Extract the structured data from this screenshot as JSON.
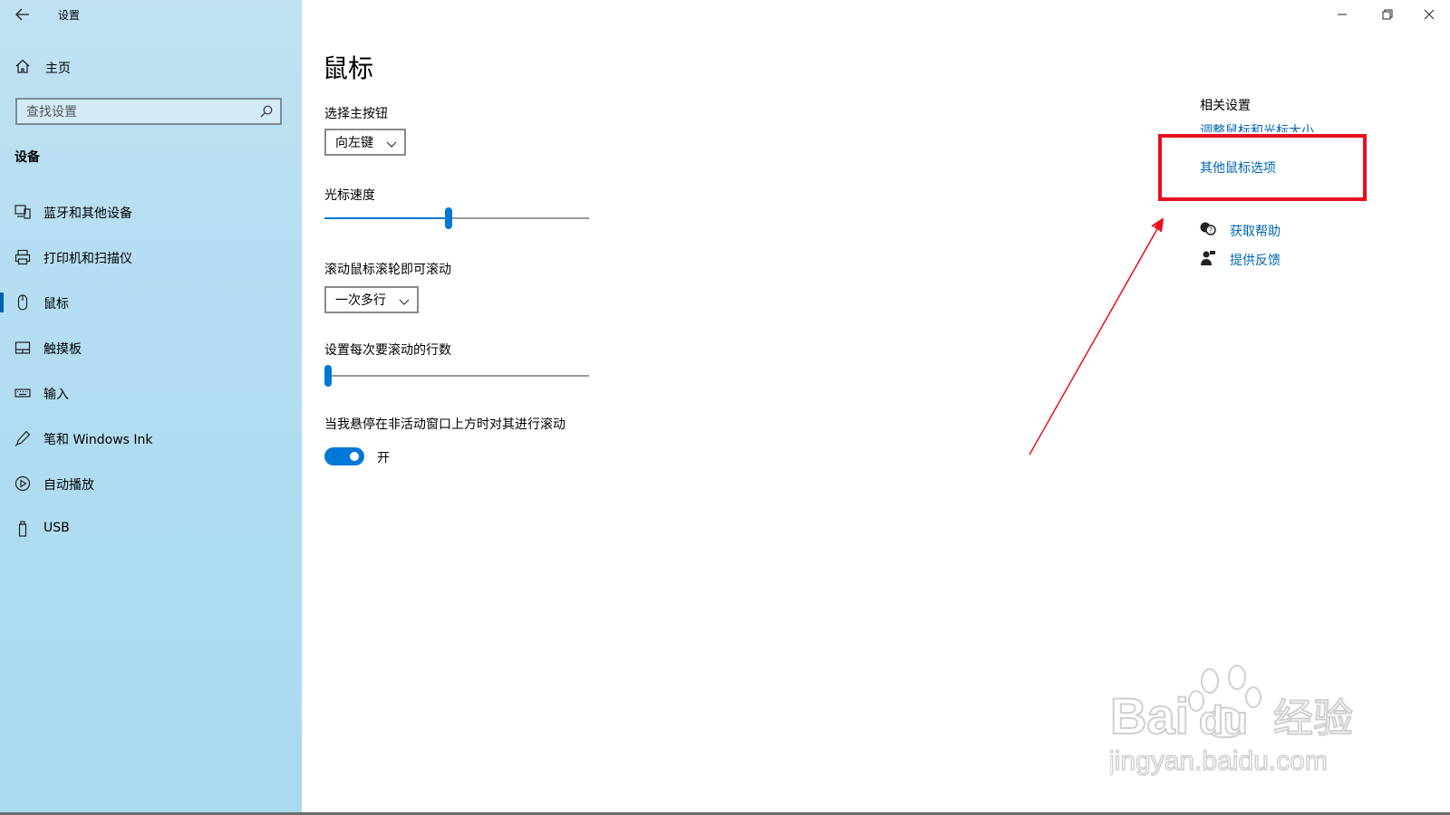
{
  "window": {
    "title": "设置",
    "controls": {
      "minimize": "minimize-icon",
      "maximize": "restore-icon",
      "close": "close-icon"
    }
  },
  "sidebar": {
    "home_label": "主页",
    "search_placeholder": "查找设置",
    "section_title": "设备",
    "items": [
      {
        "label": "蓝牙和其他设备",
        "icon": "bluetooth-devices-icon",
        "active": false
      },
      {
        "label": "打印机和扫描仪",
        "icon": "printer-icon",
        "active": false
      },
      {
        "label": "鼠标",
        "icon": "mouse-icon",
        "active": true
      },
      {
        "label": "触摸板",
        "icon": "touchpad-icon",
        "active": false
      },
      {
        "label": "输入",
        "icon": "keyboard-icon",
        "active": false
      },
      {
        "label": "笔和 Windows Ink",
        "icon": "pen-icon",
        "active": false
      },
      {
        "label": "自动播放",
        "icon": "autoplay-icon",
        "active": false
      },
      {
        "label": "USB",
        "icon": "usb-icon",
        "active": false
      }
    ]
  },
  "main": {
    "title": "鼠标",
    "primary_button": {
      "label": "选择主按钮",
      "value": "向左键"
    },
    "cursor_speed": {
      "label": "光标速度",
      "level": 0.47
    },
    "wheel_scroll": {
      "label": "滚动鼠标滚轮即可滚动",
      "value": "一次多行"
    },
    "lines_to_scroll": {
      "label": "设置每次要滚动的行数",
      "level": 0.0
    },
    "inactive_scroll": {
      "label": "当我悬停在非活动窗口上方时对其进行滚动",
      "state": "开",
      "on": true
    }
  },
  "related": {
    "title": "相关设置",
    "links": [
      "调整鼠标和光标大小",
      "其他鼠标选项"
    ],
    "get_help": "获取帮助",
    "feedback": "提供反馈"
  },
  "colors": {
    "accent": "#0078d7",
    "link": "#0066b4",
    "highlight": "#e8101e",
    "sidebar": "#b2ddf1"
  },
  "watermark": {
    "brand": "Bai",
    "suffix": "du",
    "cn": "经验",
    "url": "jingyan.baidu.com"
  }
}
